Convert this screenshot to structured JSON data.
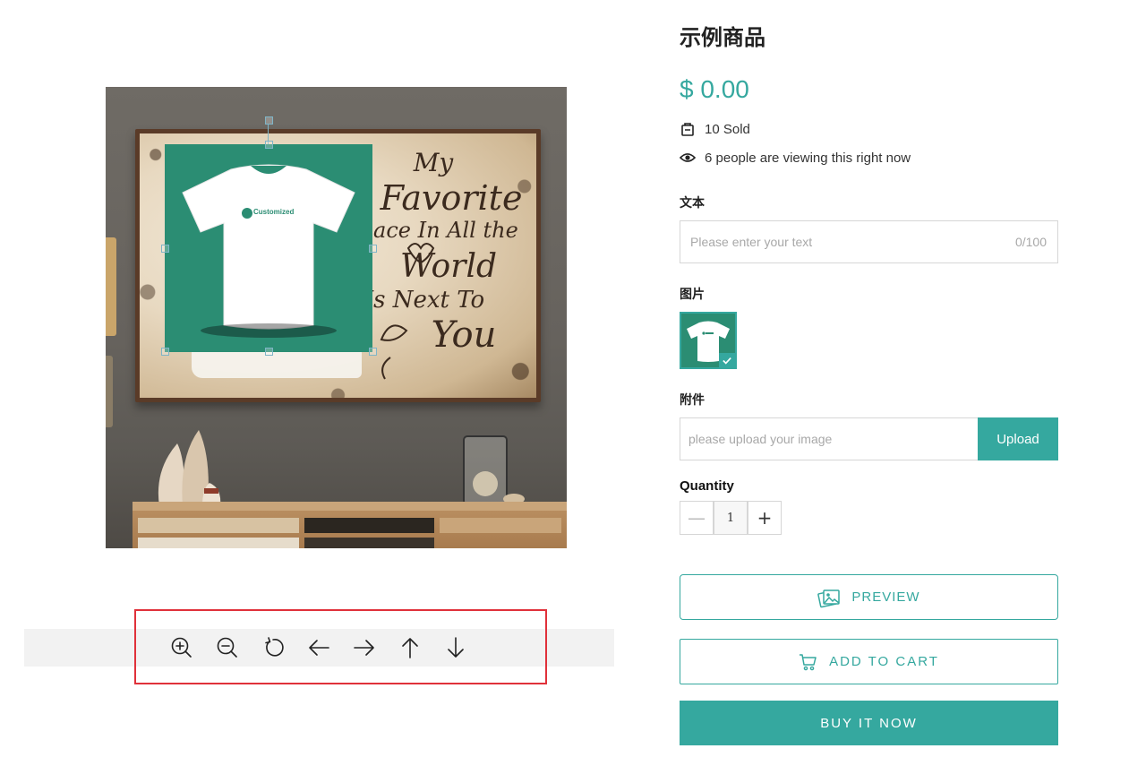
{
  "product": {
    "title": "示例商品",
    "price": "$ 0.00",
    "sold": "10 Sold",
    "viewing": "6 people are viewing this right now"
  },
  "preview_image": {
    "artwork_lines": [
      "My",
      "Favorite",
      "Place In All the",
      "World",
      "Is Next To",
      "You"
    ],
    "design_label": "Customized"
  },
  "toolbar": {
    "tools": [
      {
        "name": "zoom-in",
        "icon": "zoom-in-icon"
      },
      {
        "name": "zoom-out",
        "icon": "zoom-out-icon"
      },
      {
        "name": "rotate",
        "icon": "rotate-icon"
      },
      {
        "name": "move-left",
        "icon": "arrow-left-icon"
      },
      {
        "name": "move-right",
        "icon": "arrow-right-icon"
      },
      {
        "name": "move-up",
        "icon": "arrow-up-icon"
      },
      {
        "name": "move-down",
        "icon": "arrow-down-icon"
      }
    ]
  },
  "form": {
    "text_label": "文本",
    "text_placeholder": "Please enter your text",
    "text_value": "",
    "text_counter": "0/100",
    "image_label": "图片",
    "attachment_label": "附件",
    "upload_placeholder": "please upload your image",
    "upload_button": "Upload",
    "quantity_label": "Quantity",
    "quantity_value": "1",
    "minus_symbol": "—",
    "plus_symbol": "+"
  },
  "actions": {
    "preview": "PREVIEW",
    "add_to_cart": "ADD TO CART",
    "buy_now": "BUY IT NOW"
  },
  "colors": {
    "accent": "#35a89f",
    "design_green": "#2b8d73",
    "highlight_red": "#e0313a"
  }
}
